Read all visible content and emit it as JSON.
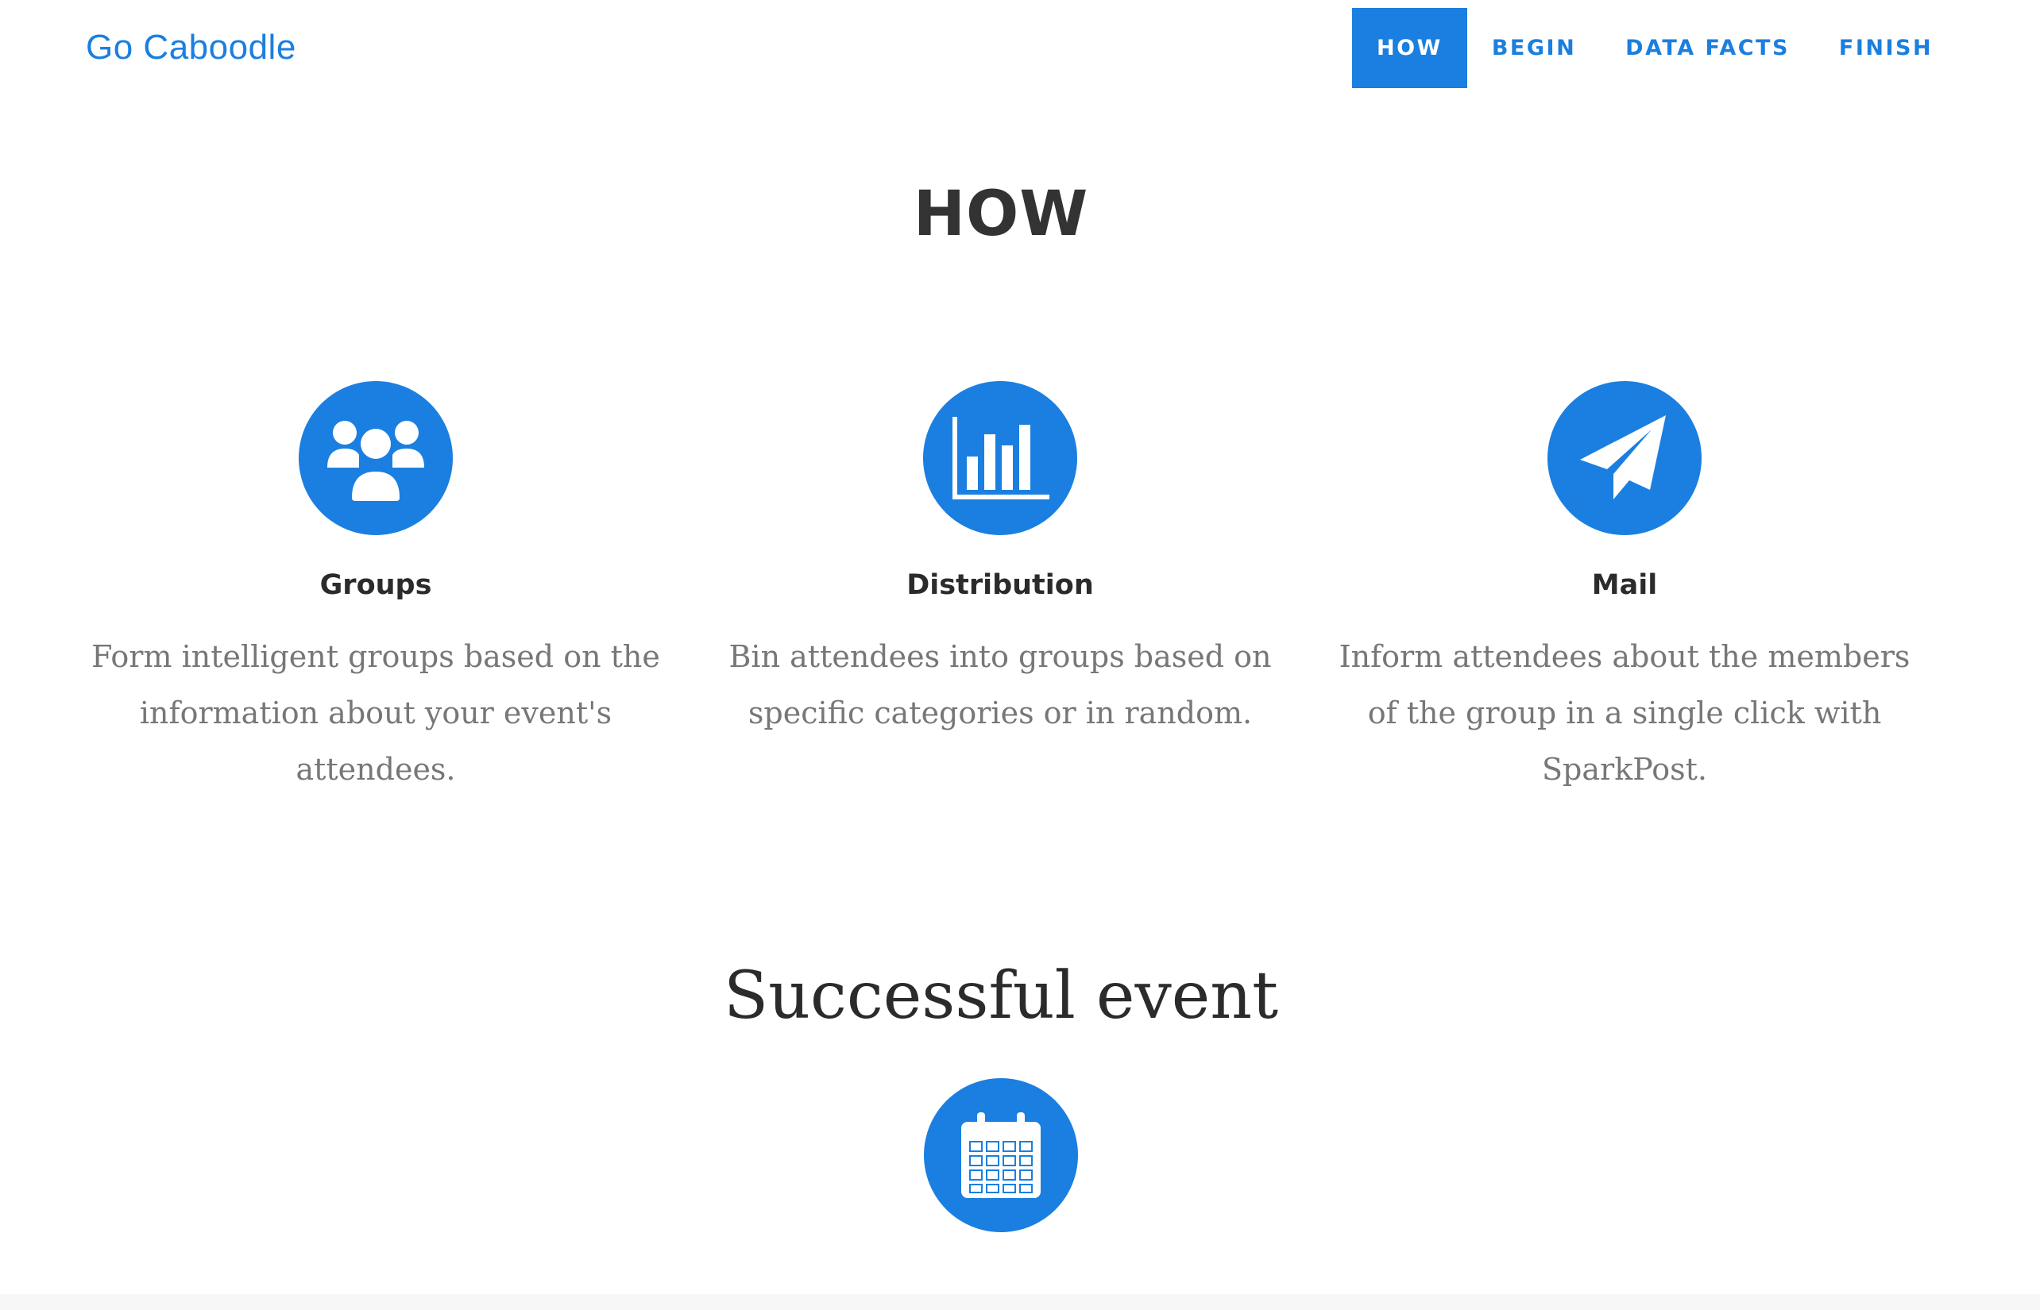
{
  "navbar": {
    "brand": "Go Caboodle",
    "items": [
      {
        "label": "HOW",
        "active": true
      },
      {
        "label": "BEGIN",
        "active": false
      },
      {
        "label": "DATA FACTS",
        "active": false
      },
      {
        "label": "FINISH",
        "active": false
      }
    ]
  },
  "how_section": {
    "title": "HOW",
    "features": [
      {
        "icon": "users-icon",
        "title": "Groups",
        "description": "Form intelligent groups based on the information about your event's attendees."
      },
      {
        "icon": "bar-chart-icon",
        "title": "Distribution",
        "description": "Bin attendees into groups based on specific categories or in random."
      },
      {
        "icon": "paper-plane-icon",
        "title": "Mail",
        "description": "Inform attendees about the members of the group in a single click with SparkPost."
      }
    ]
  },
  "event_section": {
    "title": "Successful event",
    "icon": "calendar-icon"
  },
  "colors": {
    "accent": "#1a7fe0",
    "heading": "#333333",
    "body_text": "#777777",
    "background": "#ffffff"
  }
}
